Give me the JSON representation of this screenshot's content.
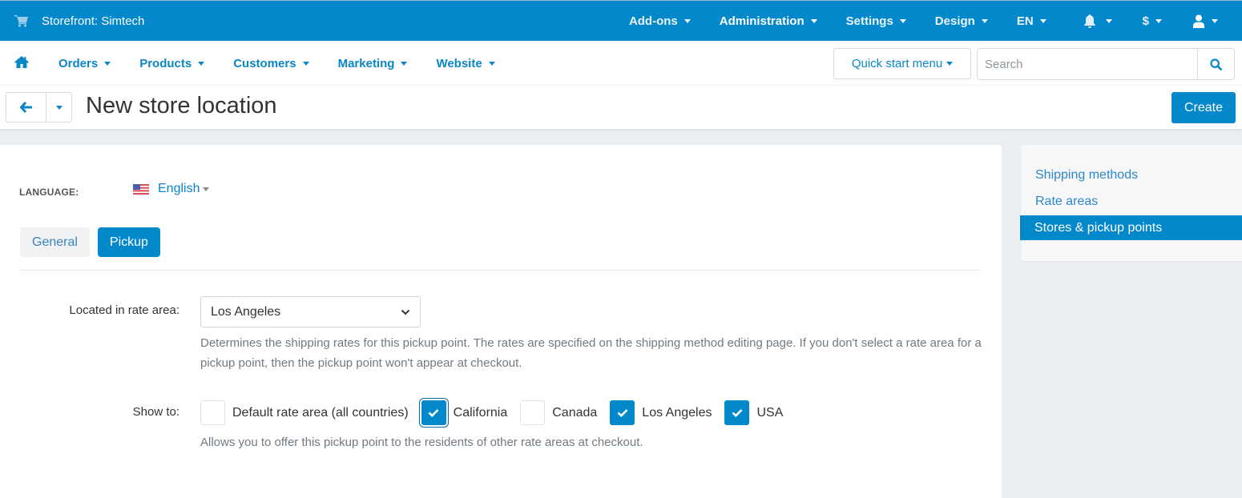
{
  "topbar": {
    "brand_icon": "cart-icon",
    "brand": "Storefront: Simtech",
    "menu": [
      {
        "label": "Add-ons",
        "active": false
      },
      {
        "label": "Administration",
        "active": true
      },
      {
        "label": "Settings",
        "active": false
      },
      {
        "label": "Design",
        "active": false
      },
      {
        "label": "EN",
        "active": false
      }
    ],
    "icons": [
      {
        "icon": "bell-icon"
      },
      {
        "icon": "dollar-icon",
        "label": "$"
      },
      {
        "icon": "user-icon"
      }
    ]
  },
  "subnav": {
    "home_icon": "home-icon",
    "menu": [
      "Orders",
      "Products",
      "Customers",
      "Marketing",
      "Website"
    ],
    "quick_start": "Quick start menu",
    "search_placeholder": "Search",
    "search_value": ""
  },
  "titlebar": {
    "title": "New store location",
    "create_label": "Create"
  },
  "main": {
    "language_label": "LANGUAGE:",
    "language_value": "English",
    "tabs": [
      {
        "label": "General",
        "active": false
      },
      {
        "label": "Pickup",
        "active": true
      }
    ],
    "rate_area": {
      "label": "Located in rate area:",
      "value": "Los Angeles",
      "help": "Determines the shipping rates for this pickup point. The rates are specified on the shipping method editing page. If you don't select a rate area for a pickup point, then the pickup point won't appear at checkout."
    },
    "show_to": {
      "label": "Show to:",
      "options": [
        {
          "label": "Default rate area (all countries)",
          "checked": false,
          "focused": false
        },
        {
          "label": "California",
          "checked": true,
          "focused": true
        },
        {
          "label": "Canada",
          "checked": false,
          "focused": false
        },
        {
          "label": "Los Angeles",
          "checked": true,
          "focused": false
        },
        {
          "label": "USA",
          "checked": true,
          "focused": false
        }
      ],
      "help": "Allows you to offer this pickup point to the residents of other rate areas at checkout."
    }
  },
  "sidebar": {
    "items": [
      {
        "label": "Shipping methods",
        "active": false
      },
      {
        "label": "Rate areas",
        "active": false
      },
      {
        "label": "Stores & pickup points",
        "active": true
      }
    ]
  },
  "colors": {
    "brand_blue": "#0388cc",
    "link_blue": "#0a86c6",
    "page_bg": "#eceff2"
  }
}
